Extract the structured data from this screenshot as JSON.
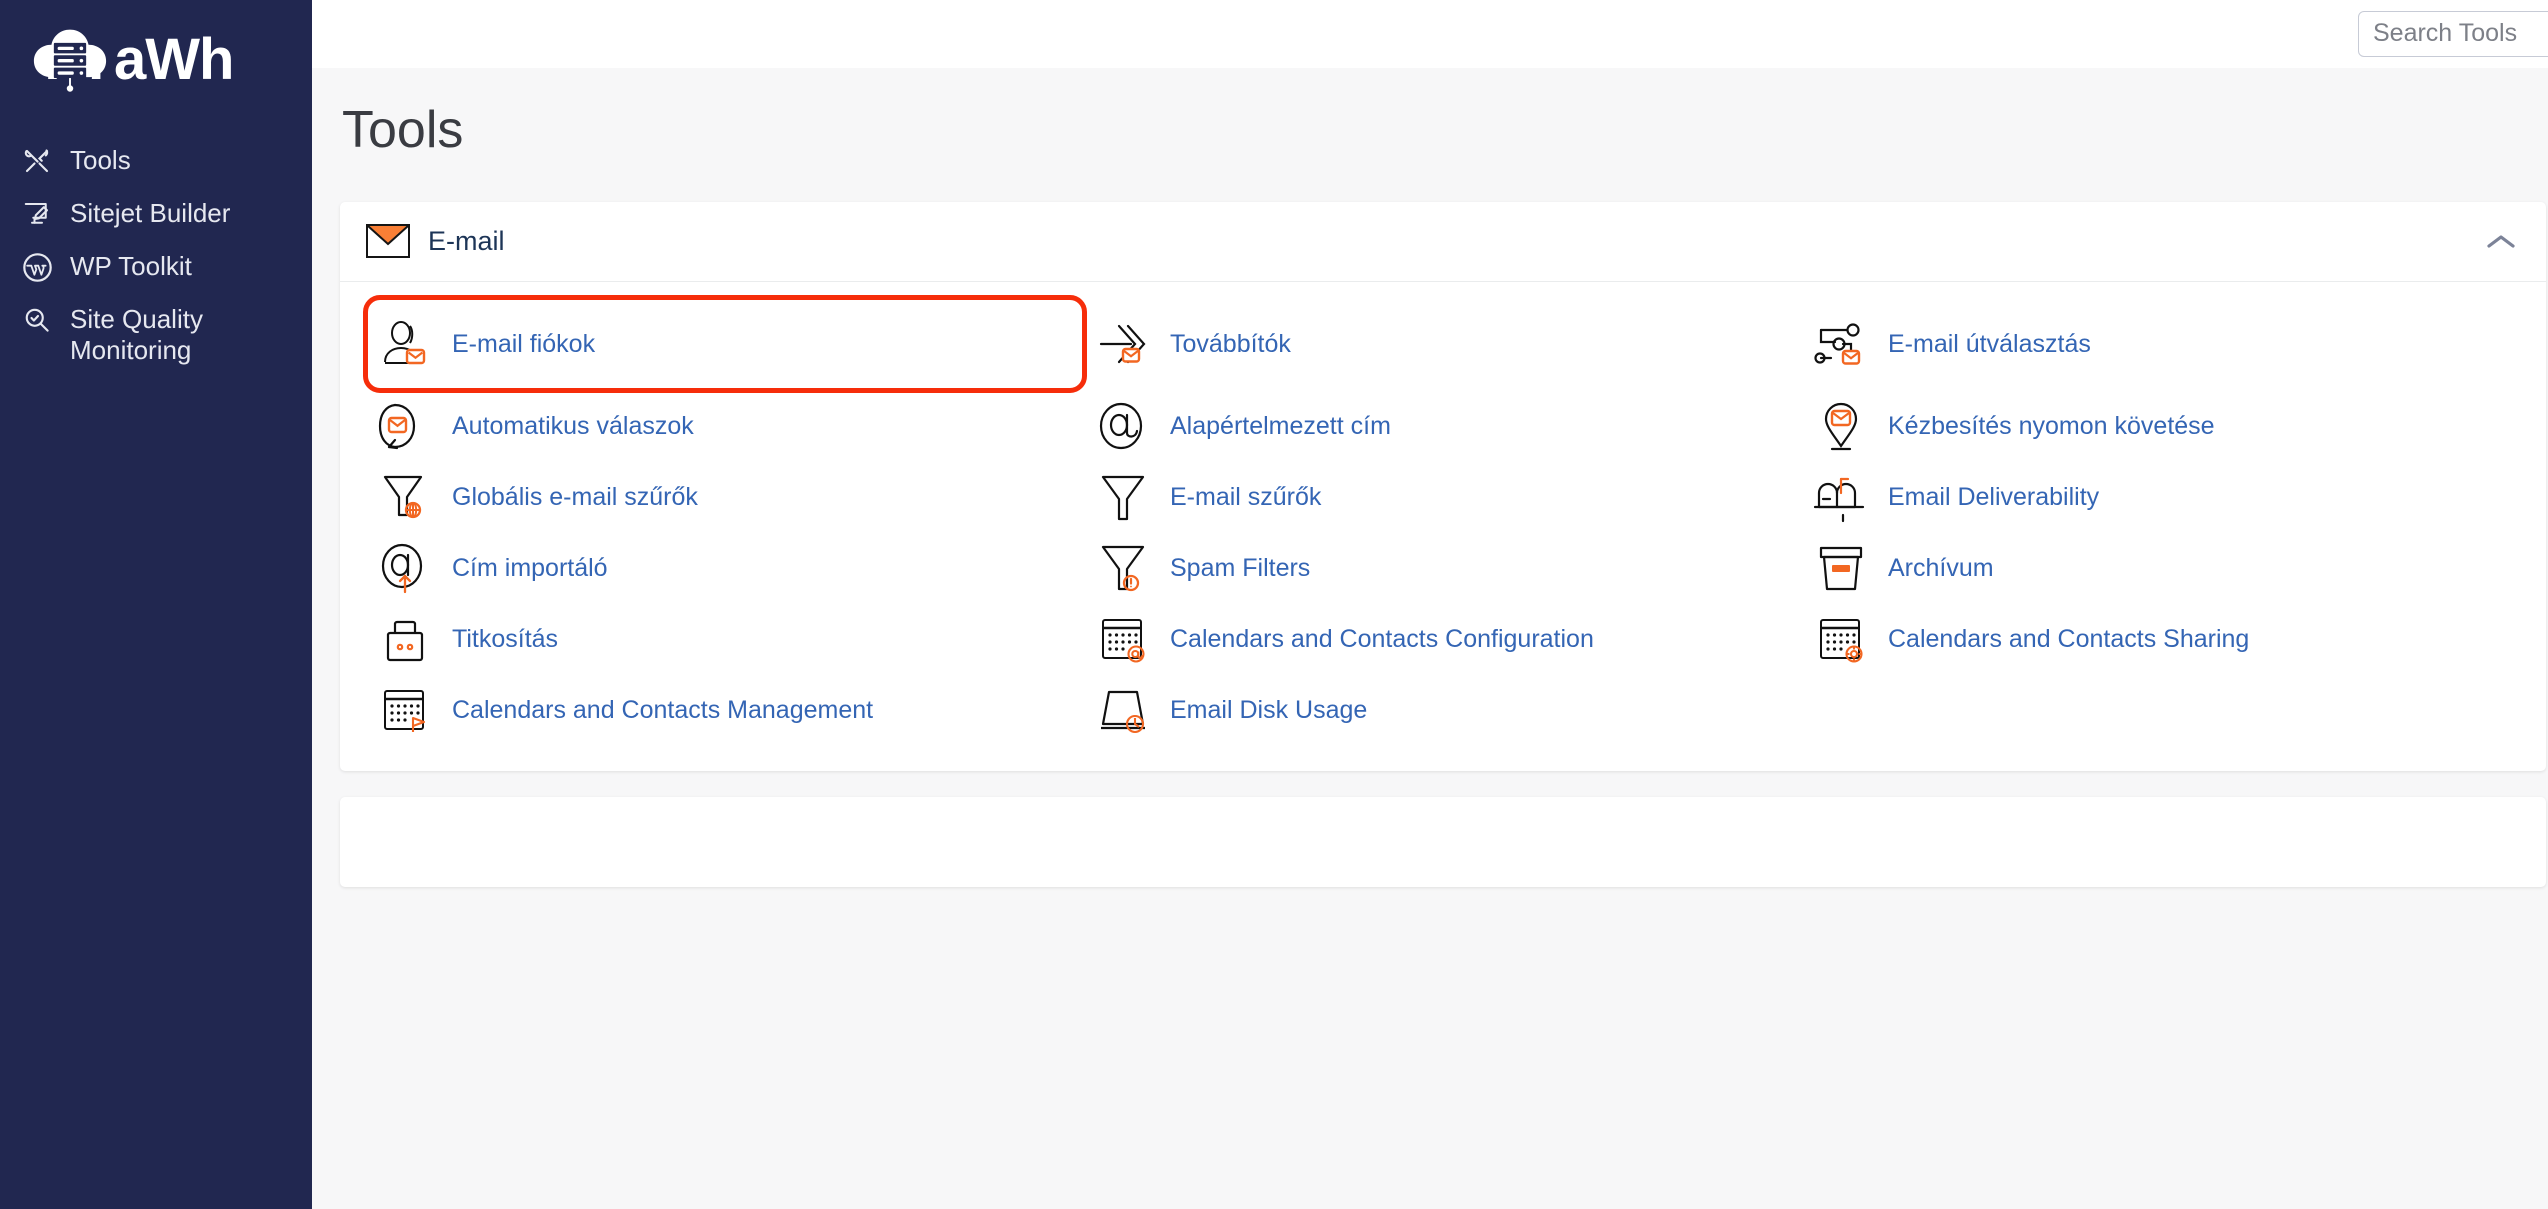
{
  "sidebar": {
    "logo": {
      "text": "aWh",
      "icon": "cloud-server-logo"
    },
    "items": [
      {
        "label": "Tools",
        "icon": "tools-icon"
      },
      {
        "label": "Sitejet Builder",
        "icon": "monitor-pencil-icon"
      },
      {
        "label": "WP Toolkit",
        "icon": "wordpress-icon"
      },
      {
        "label": "Site Quality Monitoring",
        "icon": "magnifier-check-icon"
      }
    ]
  },
  "topbar": {
    "search_placeholder": "Search Tools",
    "search_value": ""
  },
  "page": {
    "title": "Tools"
  },
  "email_panel": {
    "icon": "envelope-icon",
    "title": "E-mail",
    "collapse_icon": "chevron-up-icon",
    "tiles": [
      {
        "label": "E-mail fiókok",
        "icon": "user-envelope-icon",
        "highlighted": true
      },
      {
        "label": "Továbbítók",
        "icon": "arrow-forward-envelope-icon",
        "highlighted": false
      },
      {
        "label": "E-mail útválasztás",
        "icon": "routing-nodes-envelope-icon",
        "highlighted": false
      },
      {
        "label": "Automatikus válaszok",
        "icon": "autoresponder-loop-envelope-icon",
        "highlighted": false
      },
      {
        "label": "Alapértelmezett cím",
        "icon": "at-sign-icon",
        "highlighted": false
      },
      {
        "label": "Kézbesítés nyomon követése",
        "icon": "map-pin-envelope-icon",
        "highlighted": false
      },
      {
        "label": "Globális e-mail szűrők",
        "icon": "funnel-globe-icon",
        "highlighted": false
      },
      {
        "label": "E-mail szűrők",
        "icon": "funnel-icon",
        "highlighted": false
      },
      {
        "label": "Email Deliverability",
        "icon": "mailbox-icon",
        "highlighted": false
      },
      {
        "label": "Cím importáló",
        "icon": "at-sign-upload-icon",
        "highlighted": false
      },
      {
        "label": "Spam Filters",
        "icon": "funnel-alert-icon",
        "highlighted": false
      },
      {
        "label": "Archívum",
        "icon": "archive-box-icon",
        "highlighted": false
      },
      {
        "label": "Titkosítás",
        "icon": "padlock-icon",
        "highlighted": false
      },
      {
        "label": "Calendars and Contacts Configuration",
        "icon": "calendar-at-icon",
        "highlighted": false
      },
      {
        "label": "Calendars and Contacts Sharing",
        "icon": "calendar-share-icon",
        "highlighted": false
      },
      {
        "label": "Calendars and Contacts Management",
        "icon": "calendar-flag-icon",
        "highlighted": false
      },
      {
        "label": "Email Disk Usage",
        "icon": "disk-usage-icon",
        "highlighted": false
      }
    ]
  },
  "colors": {
    "sidebar_bg": "#212750",
    "accent_orange": "#f26722",
    "link_blue": "#3465b4",
    "highlight_red": "#f62d0a",
    "page_bg": "#f7f7f8"
  }
}
